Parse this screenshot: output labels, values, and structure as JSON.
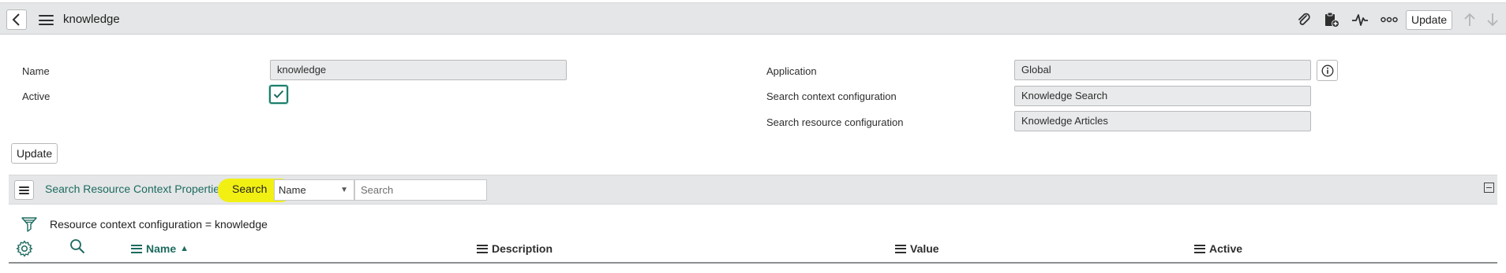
{
  "header": {
    "title": "knowledge",
    "update_label": "Update"
  },
  "form": {
    "name_label": "Name",
    "name_value": "knowledge",
    "active_label": "Active",
    "active_checked": true,
    "application_label": "Application",
    "application_value": "Global",
    "search_context_label": "Search context configuration",
    "search_context_value": "Knowledge Search",
    "search_resource_label": "Search resource configuration",
    "search_resource_value": "Knowledge Articles",
    "update_label": "Update"
  },
  "related_list": {
    "title": "Search Resource Context Properties",
    "search_label": "Search",
    "field_selected": "Name",
    "search_placeholder": "Search",
    "filter_text": "Resource context configuration = knowledge",
    "columns": [
      {
        "label": "Name",
        "sorted": "ascending"
      },
      {
        "label": "Description"
      },
      {
        "label": "Value"
      },
      {
        "label": "Active"
      }
    ]
  },
  "colors": {
    "accent": "#1d6b60",
    "highlight": "#f2f013",
    "toolbar_bg": "#e4e6e7"
  }
}
